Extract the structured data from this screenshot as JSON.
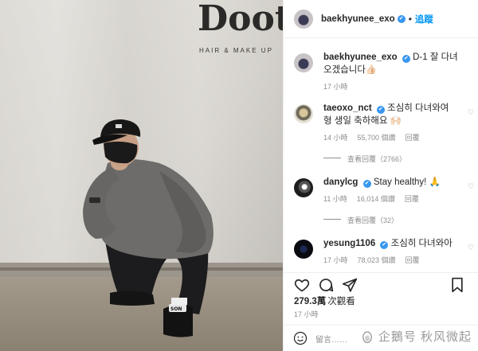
{
  "photo": {
    "sign_text": "Doot",
    "sign_subtext": "HAIR & MAKE UP",
    "shoe_text": "SON"
  },
  "header": {
    "username": "baekhyunee_exo",
    "verified_mark": "✔",
    "separator": "•",
    "follow_label": "追蹤"
  },
  "caption": {
    "username": "baekhyunee_exo",
    "text": "D-1 잘 다녀오겠습니다👍🏻",
    "time": "17 小時"
  },
  "comments": [
    {
      "username": "taeoxo_nct",
      "text": "조심히 다녀와여 형 생일 축하해요 🙌🏻",
      "time": "14 小時",
      "likes": "55,700 個讚",
      "reply": "回覆",
      "view_replies": "查看回覆（2766）"
    },
    {
      "username": "danylcg",
      "text": "Stay healthy! 🙏",
      "time": "11 小時",
      "likes": "16,014 個讚",
      "reply": "回覆",
      "view_replies": "查看回覆（32）"
    },
    {
      "username": "yesung1106",
      "text": "조심히 다녀와아",
      "time": "17 小時",
      "likes": "78,023 個讚",
      "reply": "回覆"
    }
  ],
  "stats": {
    "views": "279.3萬",
    "views_label": "次觀看",
    "posted": "17 小時"
  },
  "comment_box": {
    "placeholder": "留言……"
  },
  "watermark": {
    "text": "企鵝号 秋风微起"
  },
  "colors": {
    "accent": "#0095f6",
    "verified": "#3897f0",
    "muted": "#8e8e8e"
  }
}
